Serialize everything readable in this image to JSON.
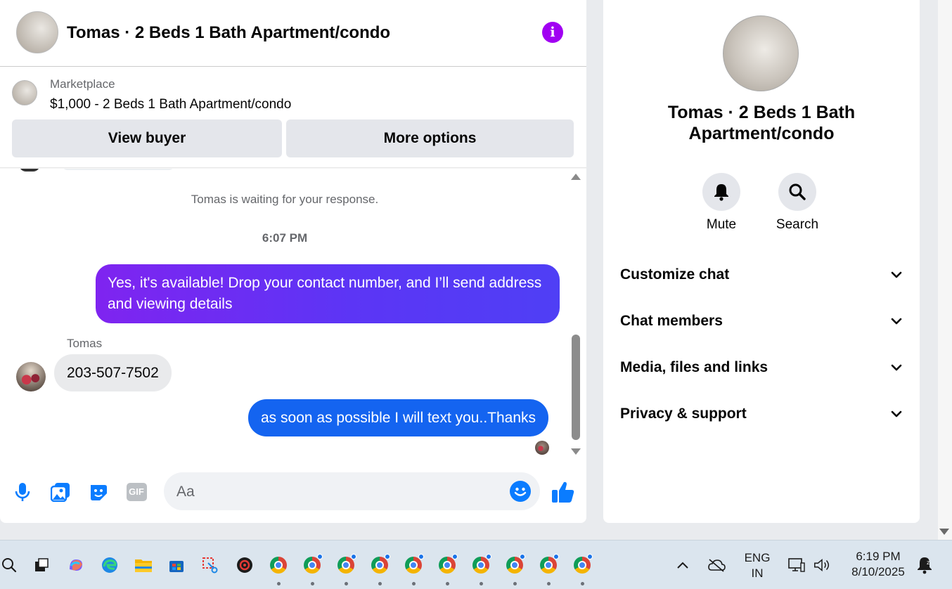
{
  "chat": {
    "title": "Tomas · 2 Beds 1 Bath Apartment/condo",
    "marketplace_label": "Marketplace",
    "listing": "$1,000 - 2 Beds 1 Bath Apartment/condo",
    "view_buyer_label": "View buyer",
    "more_options_label": "More options",
    "info_icon_glyph": "i",
    "waiting_text": "Tomas is waiting for your response.",
    "timestamp": "6:07 PM",
    "messages": [
      {
        "direction": "outgoing",
        "text": "Yes, it's available! Drop your contact number, and I’ll send address and viewing details"
      },
      {
        "direction": "incoming",
        "sender": "Tomas",
        "text": "203-507-7502"
      },
      {
        "direction": "outgoing",
        "text": "as soon as possible I will text you..Thanks"
      }
    ],
    "composer": {
      "placeholder": "Aa",
      "icons": [
        "microphone-icon",
        "photo-icon",
        "sticker-icon",
        "gif-icon",
        "emoji-icon",
        "like-icon"
      ],
      "gif_label": "GIF"
    },
    "colors": {
      "accent": "#0a7cff",
      "info": "#a100f2",
      "outgoing_gradient_start": "#7f24f0",
      "outgoing_blue": "#1464f0"
    }
  },
  "info_panel": {
    "title": "Tomas · 2 Beds 1 Bath Apartment/condo",
    "actions": [
      {
        "label": "Mute",
        "icon": "bell-icon"
      },
      {
        "label": "Search",
        "icon": "search-icon"
      }
    ],
    "sections": [
      {
        "label": "Customize chat"
      },
      {
        "label": "Chat members"
      },
      {
        "label": "Media, files and links"
      },
      {
        "label": "Privacy & support"
      }
    ]
  },
  "taskbar": {
    "apps": [
      "search-icon",
      "task-view-icon",
      "copilot-icon",
      "edge-icon",
      "file-explorer-icon",
      "store-icon",
      "snipping-tool-icon",
      "app-icon",
      "chrome-icon"
    ],
    "chrome_windows": 10,
    "language_line1": "ENG",
    "language_line2": "IN",
    "time": "6:19 PM",
    "date": "8/10/2025"
  }
}
